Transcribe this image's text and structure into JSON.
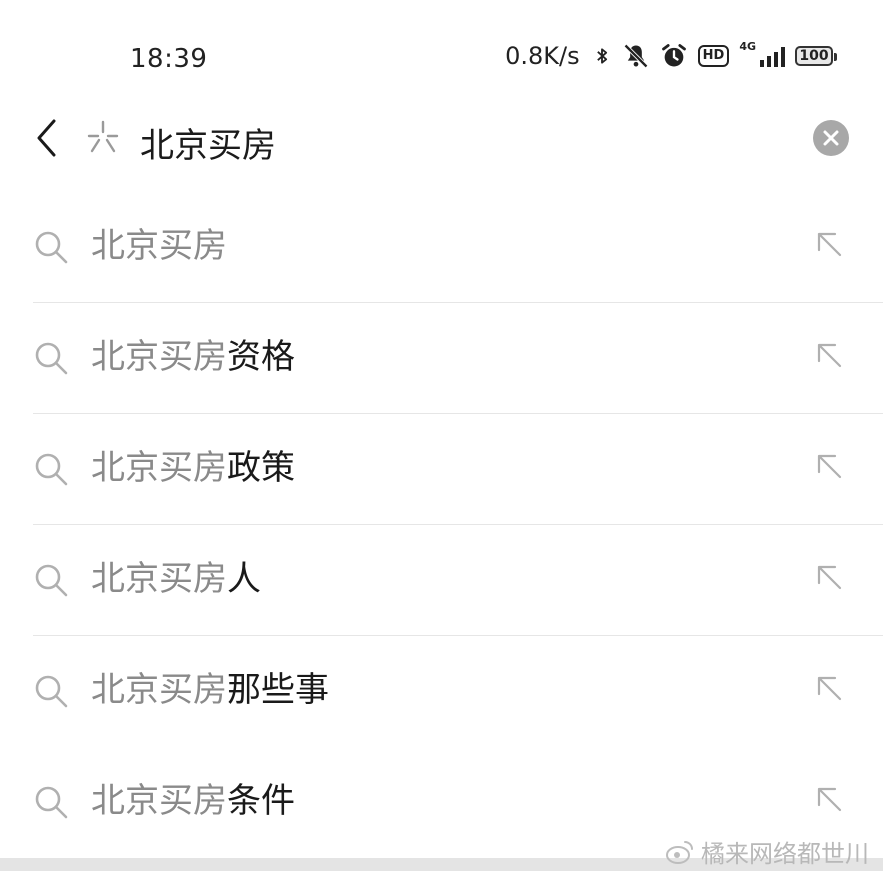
{
  "status_bar": {
    "time": "18:39",
    "net_speed": "0.8K/s",
    "hd_label": "HD",
    "network_type": "4G",
    "battery": "100",
    "icons": [
      "bluetooth-icon",
      "mute-icon",
      "alarm-icon",
      "hd-icon",
      "signal-icon",
      "battery-icon"
    ]
  },
  "search": {
    "query": "北京买房",
    "back_icon": "chevron-left-icon",
    "spark_icon": "spark-icon",
    "clear_icon": "clear-icon"
  },
  "suggestions": [
    {
      "prefix": "北京买房",
      "suffix": ""
    },
    {
      "prefix": "北京买房",
      "suffix": "资格"
    },
    {
      "prefix": "北京买房",
      "suffix": "政策"
    },
    {
      "prefix": "北京买房",
      "suffix": "人"
    },
    {
      "prefix": "北京买房",
      "suffix": "那些事"
    },
    {
      "prefix": "北京买房",
      "suffix": "条件"
    }
  ],
  "watermark": "橘来网络都世川",
  "colors": {
    "background": "#ffffff",
    "text_primary": "#1a1a1a",
    "text_muted": "#8a8a8a",
    "icon_muted": "#b0b0b0",
    "divider": "#e6e6e6"
  }
}
